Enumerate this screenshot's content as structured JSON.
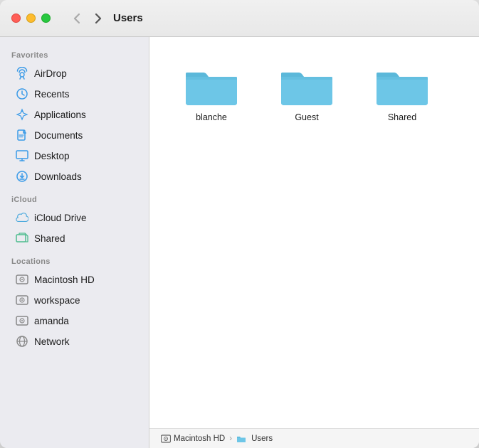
{
  "window": {
    "title": "Users"
  },
  "traffic_lights": {
    "close_label": "close",
    "minimize_label": "minimize",
    "maximize_label": "maximize"
  },
  "nav": {
    "back_label": "‹",
    "forward_label": "›"
  },
  "sidebar": {
    "sections": [
      {
        "label": "Favorites",
        "items": [
          {
            "id": "airdrop",
            "label": "AirDrop",
            "icon": "airdrop"
          },
          {
            "id": "recents",
            "label": "Recents",
            "icon": "recents"
          },
          {
            "id": "applications",
            "label": "Applications",
            "icon": "applications"
          },
          {
            "id": "documents",
            "label": "Documents",
            "icon": "documents"
          },
          {
            "id": "desktop",
            "label": "Desktop",
            "icon": "desktop"
          },
          {
            "id": "downloads",
            "label": "Downloads",
            "icon": "downloads"
          }
        ]
      },
      {
        "label": "iCloud",
        "items": [
          {
            "id": "icloud-drive",
            "label": "iCloud Drive",
            "icon": "icloud"
          },
          {
            "id": "shared-icloud",
            "label": "Shared",
            "icon": "shared-icloud"
          }
        ]
      },
      {
        "label": "Locations",
        "items": [
          {
            "id": "macintosh-hd",
            "label": "Macintosh HD",
            "icon": "hd"
          },
          {
            "id": "workspace",
            "label": "workspace",
            "icon": "hd"
          },
          {
            "id": "amanda",
            "label": "amanda",
            "icon": "hd"
          },
          {
            "id": "network",
            "label": "Network",
            "icon": "network"
          }
        ]
      }
    ]
  },
  "folders": [
    {
      "id": "blanche",
      "name": "blanche"
    },
    {
      "id": "guest",
      "name": "Guest"
    },
    {
      "id": "shared",
      "name": "Shared"
    }
  ],
  "statusbar": {
    "path_parts": [
      "Macintosh HD",
      "Users"
    ],
    "separator": "›"
  },
  "colors": {
    "folder_body": "#6dc6e7",
    "folder_tab": "#4aa8cc",
    "folder_shadow": "#5ab8d8",
    "accent": "#3b9be8",
    "sidebar_bg": "#ebebf0",
    "window_bg": "#ffffff"
  }
}
